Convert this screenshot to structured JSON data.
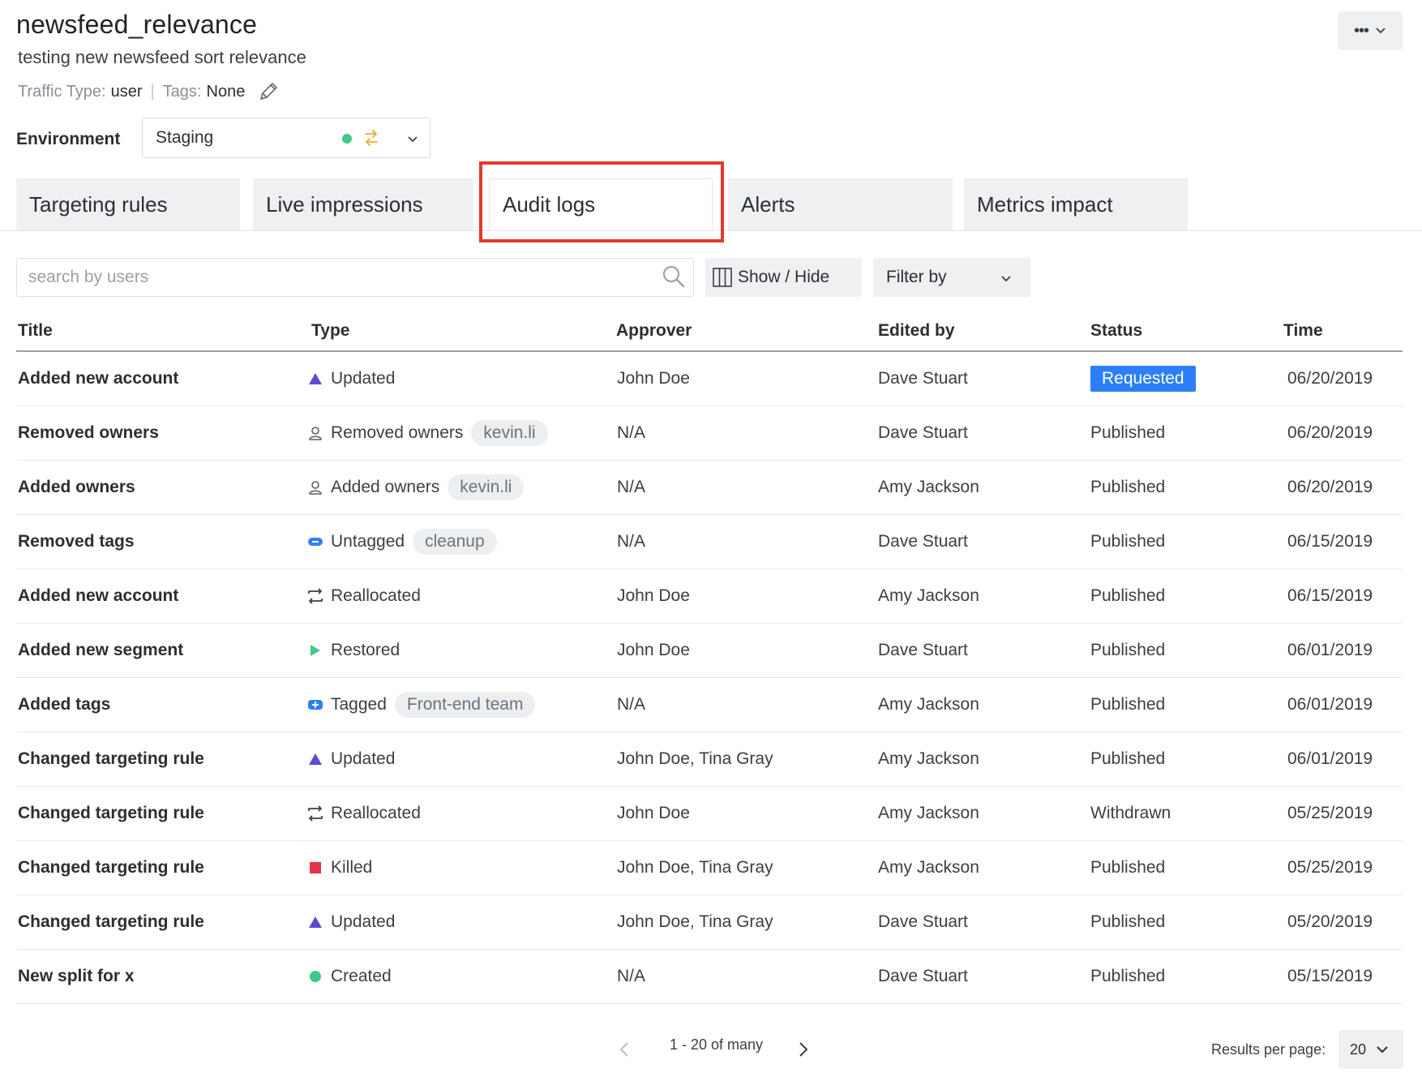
{
  "header": {
    "title": "newsfeed_relevance",
    "description": "testing new newsfeed sort relevance",
    "traffic_type_label": "Traffic Type:",
    "traffic_type_value": "user",
    "separator": "|",
    "tags_label": "Tags:",
    "tags_value": "None",
    "more_label": "•••"
  },
  "environment": {
    "label": "Environment",
    "selected": "Staging",
    "status_color": "#3ec98a"
  },
  "tabs": [
    {
      "label": "Targeting rules"
    },
    {
      "label": "Live impressions"
    },
    {
      "label": "Audit logs",
      "active": true
    },
    {
      "label": "Alerts"
    },
    {
      "label": "Metrics impact"
    }
  ],
  "toolbar": {
    "search_placeholder": "search by users",
    "show_hide_label": "Show / Hide",
    "filter_label": "Filter by"
  },
  "table": {
    "columns": [
      "Title",
      "Type",
      "Approver",
      "Edited by",
      "Status",
      "Time"
    ],
    "rows": [
      {
        "title": "Added new account",
        "type_icon": "triangle-icon",
        "type": "Updated",
        "tag": "",
        "approver": "John Doe",
        "edited_by": "Dave Stuart",
        "status": "Requested",
        "time": "06/20/2019"
      },
      {
        "title": "Removed owners",
        "type_icon": "user-icon",
        "type": "Removed owners",
        "tag": "kevin.li",
        "approver": "N/A",
        "edited_by": "Dave Stuart",
        "status": "Published",
        "time": "06/20/2019"
      },
      {
        "title": "Added owners",
        "type_icon": "user-icon",
        "type": "Added owners",
        "tag": "kevin.li",
        "approver": "N/A",
        "edited_by": "Amy Jackson",
        "status": "Published",
        "time": "06/20/2019"
      },
      {
        "title": "Removed tags",
        "type_icon": "untag-icon",
        "type": "Untagged",
        "tag": "cleanup",
        "approver": "N/A",
        "edited_by": "Dave Stuart",
        "status": "Published",
        "time": "06/15/2019"
      },
      {
        "title": "Added new account",
        "type_icon": "reallocate-icon",
        "type": "Reallocated",
        "tag": "",
        "approver": "John Doe",
        "edited_by": "Amy Jackson",
        "status": "Published",
        "time": "06/15/2019"
      },
      {
        "title": "Added new segment",
        "type_icon": "play-icon",
        "type": "Restored",
        "tag": "",
        "approver": "John Doe",
        "edited_by": "Dave Stuart",
        "status": "Published",
        "time": "06/01/2019"
      },
      {
        "title": "Added tags",
        "type_icon": "tag-add-icon",
        "type": "Tagged",
        "tag": "Front-end team",
        "approver": "N/A",
        "edited_by": "Amy Jackson",
        "status": "Published",
        "time": "06/01/2019"
      },
      {
        "title": "Changed targeting rule",
        "type_icon": "triangle-icon",
        "type": "Updated",
        "tag": "",
        "approver": "John Doe, Tina Gray",
        "edited_by": "Amy Jackson",
        "status": "Published",
        "time": "06/01/2019"
      },
      {
        "title": "Changed targeting rule",
        "type_icon": "reallocate-icon",
        "type": "Reallocated",
        "tag": "",
        "approver": "John Doe",
        "edited_by": "Amy Jackson",
        "status": "Withdrawn",
        "time": "05/25/2019"
      },
      {
        "title": "Changed targeting rule",
        "type_icon": "square-icon",
        "type": "Killed",
        "tag": "",
        "approver": "John Doe, Tina Gray",
        "edited_by": "Amy Jackson",
        "status": "Published",
        "time": "05/25/2019"
      },
      {
        "title": "Changed targeting rule",
        "type_icon": "triangle-icon",
        "type": "Updated",
        "tag": "",
        "approver": "John Doe, Tina Gray",
        "edited_by": "Dave Stuart",
        "status": "Published",
        "time": "05/20/2019"
      },
      {
        "title": "New split for x",
        "type_icon": "circle-icon",
        "type": "Created",
        "tag": "",
        "approver": "N/A",
        "edited_by": "Dave Stuart",
        "status": "Published",
        "time": "05/15/2019"
      }
    ]
  },
  "pagination": {
    "range_text": "1 - 20 of many",
    "results_per_page_label": "Results per page:",
    "results_per_page_value": "20"
  },
  "colors": {
    "requested_badge": "#2d7ff9",
    "highlight_box": "#e03a2b",
    "updated_icon": "#5b4bd1",
    "killed_icon": "#e5334b",
    "created_icon": "#3ec98a",
    "tag_icon": "#2d7ff9"
  }
}
